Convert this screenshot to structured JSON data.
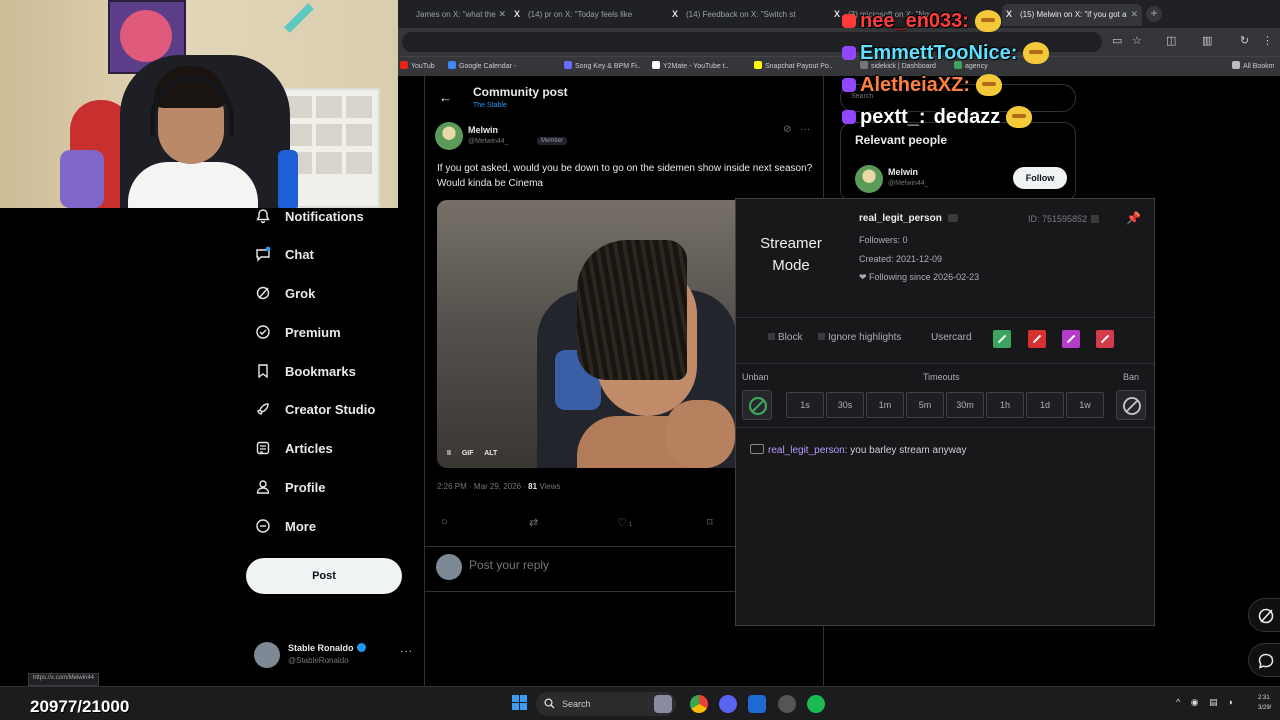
{
  "browser": {
    "tabs": [
      {
        "label": "James on X: \"what the"
      },
      {
        "label": "(14) pr on X: \"Today feels like"
      },
      {
        "label": "(14) Feedback on X: \"Switch st"
      },
      {
        "label": "(3) microsoft on X: \"Now"
      },
      {
        "label": "(15) Melwin on X: \"if you got a"
      }
    ],
    "bookmarks": [
      {
        "label": "YouTub",
        "color": "#e62117"
      },
      {
        "label": "Google Calendar -",
        "color": "#4285f4"
      },
      {
        "label": "Song Key & BPM Fi..",
        "color": "#6b6bff"
      },
      {
        "label": "Y2Mate - YouTube t..",
        "color": "#ffffff"
      },
      {
        "label": "Snapchat Payout Po..",
        "color": "#fffc00"
      },
      {
        "label": "sidekick | Dashboard",
        "color": "#777777"
      },
      {
        "label": "agency",
        "color": "#3ba55d"
      },
      {
        "label": "All Bookm",
        "color": "#bbbbbb"
      }
    ]
  },
  "nav": {
    "items": [
      {
        "label": "Notifications",
        "icon": "bell-icon"
      },
      {
        "label": "Chat",
        "icon": "chat-icon"
      },
      {
        "label": "Grok",
        "icon": "grok-icon"
      },
      {
        "label": "Premium",
        "icon": "premium-icon"
      },
      {
        "label": "Bookmarks",
        "icon": "bookmark-icon"
      },
      {
        "label": "Creator Studio",
        "icon": "rocket-icon"
      },
      {
        "label": "Articles",
        "icon": "articles-icon"
      },
      {
        "label": "Profile",
        "icon": "person-icon"
      },
      {
        "label": "More",
        "icon": "more-circle-icon"
      }
    ],
    "post_label": "Post",
    "account": {
      "name": "Stable Ronaldo",
      "handle": "@StableRonaldo"
    }
  },
  "status_url": "https://x.com/Melwin44",
  "main": {
    "title": "Community post",
    "subtitle": "The Stable",
    "post": {
      "author": "Melwin",
      "handle": "@Melwin44_",
      "badge": "Member",
      "text": "If you got asked, would you be down to go on the sidemen show inside next season? Would kinda be Cinema",
      "media_controls": [
        "II",
        "GIF",
        "ALT"
      ],
      "timestamp": "2:26 PM · Mar 29, 2026 ·",
      "views_count": "81",
      "views_label": "Views",
      "likes": "1"
    },
    "reply_placeholder": "Post your reply"
  },
  "right": {
    "search_placeholder": "Search",
    "relevant_title": "Relevant people",
    "person": {
      "name": "Melwin",
      "handle": "@Melwin44_"
    },
    "follow_label": "Follow"
  },
  "chat_overlay": [
    {
      "user": "nee_en033",
      "message": "",
      "color": "#ff3b3b",
      "badge": "#ff3b3b"
    },
    {
      "user": "EmmettTooNice",
      "message": "",
      "color": "#5fe0ff",
      "badge": "#9147ff"
    },
    {
      "user": "AletheiaXZ",
      "message": "",
      "color": "#ff7f3f",
      "badge": "#9147ff"
    },
    {
      "user": "pextt_",
      "message": "dedazz",
      "color": "#ffffff",
      "badge": "#9147ff"
    }
  ],
  "usercard": {
    "mode_line1": "Streamer",
    "mode_line2": "Mode",
    "username": "real_legit_person",
    "id": "ID: 751595852",
    "followers": "Followers: 0",
    "created": "Created: 2021-12-09",
    "following_since": "❤ Following since 2026-02-23",
    "opt_block": "Block",
    "opt_ignore": "Ignore highlights",
    "usercard_label": "Usercard",
    "color_buttons": [
      "#3ba55d",
      "#d63030",
      "#b43cc8",
      "#d43b4a"
    ],
    "label_unban": "Unban",
    "label_timeouts": "Timeouts",
    "label_ban": "Ban",
    "timeouts": [
      "1s",
      "30s",
      "1m",
      "5m",
      "30m",
      "1h",
      "1d",
      "1w"
    ],
    "message_user": "real_legit_person:",
    "message_text": "you barley stream anyway"
  },
  "taskbar": {
    "search_label": "Search",
    "clock_time": "2:31",
    "clock_date": "3/29/"
  },
  "sub_goal": "20977/21000"
}
